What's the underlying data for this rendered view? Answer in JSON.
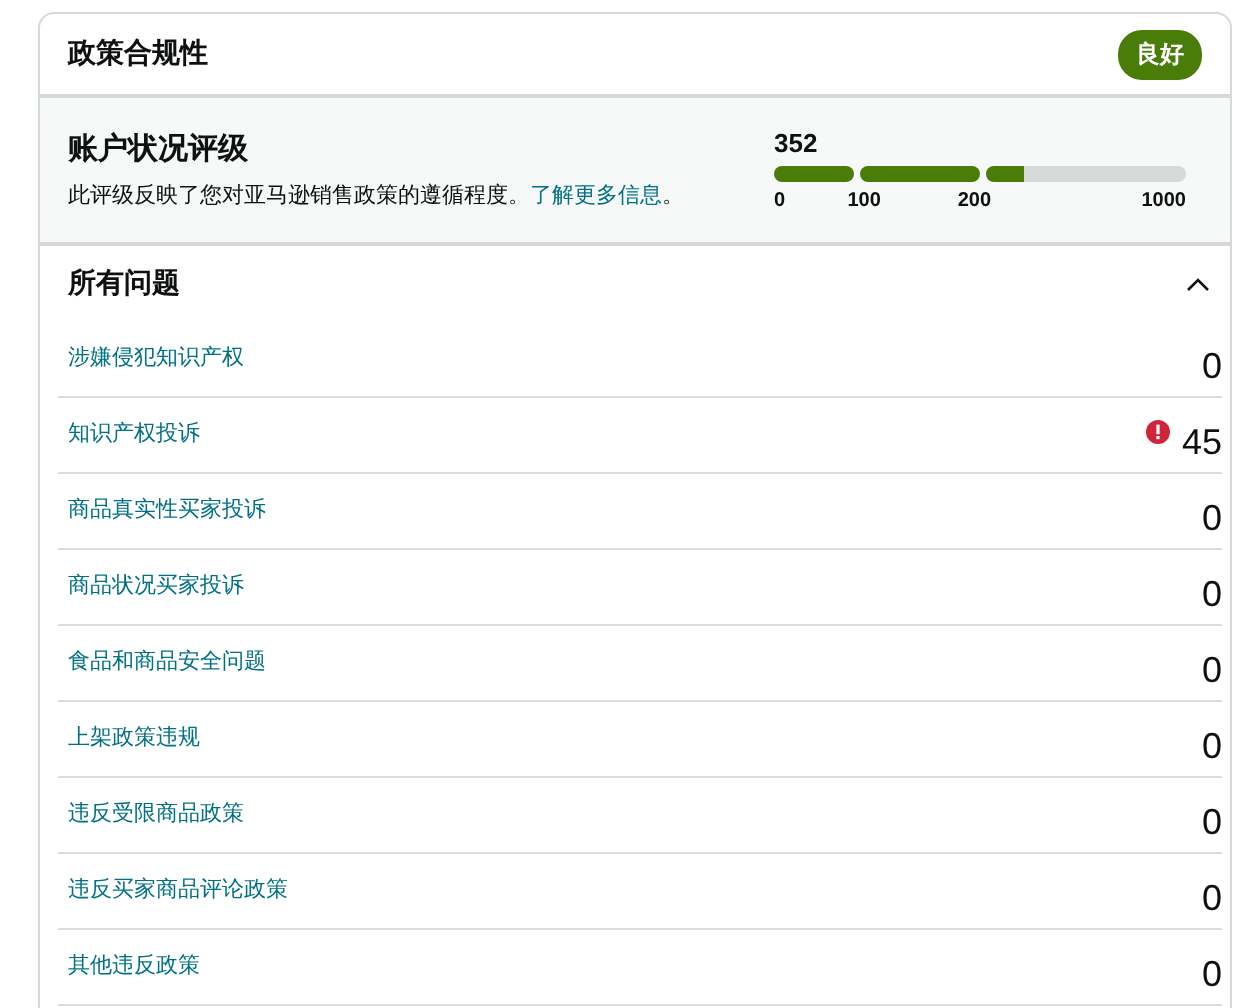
{
  "header": {
    "title": "政策合规性",
    "status_badge": "良好"
  },
  "rating": {
    "title": "账户状况评级",
    "description": "此评级反映了您对亚马逊销售政策的遵循程度。",
    "link": "了解更多信息",
    "link_end": "。",
    "score": "352",
    "segments": [
      {
        "level": 1
      },
      {
        "level": 1
      },
      {
        "level": 0.19
      }
    ],
    "ticks": [
      "0",
      "100",
      "200",
      "1000"
    ]
  },
  "issues": {
    "title": "所有问题",
    "expanded": true,
    "rows": [
      {
        "label": "涉嫌侵犯知识产权",
        "count": "0",
        "alert": false
      },
      {
        "label": "知识产权投诉",
        "count": "45",
        "alert": true
      },
      {
        "label": "商品真实性买家投诉",
        "count": "0",
        "alert": false
      },
      {
        "label": "商品状况买家投诉",
        "count": "0",
        "alert": false
      },
      {
        "label": "食品和商品安全问题",
        "count": "0",
        "alert": false
      },
      {
        "label": "上架政策违规",
        "count": "0",
        "alert": false
      },
      {
        "label": "违反受限商品政策",
        "count": "0",
        "alert": false
      },
      {
        "label": "违反买家商品评论政策",
        "count": "0",
        "alert": false
      },
      {
        "label": "其他违反政策",
        "count": "0",
        "alert": false
      }
    ]
  }
}
